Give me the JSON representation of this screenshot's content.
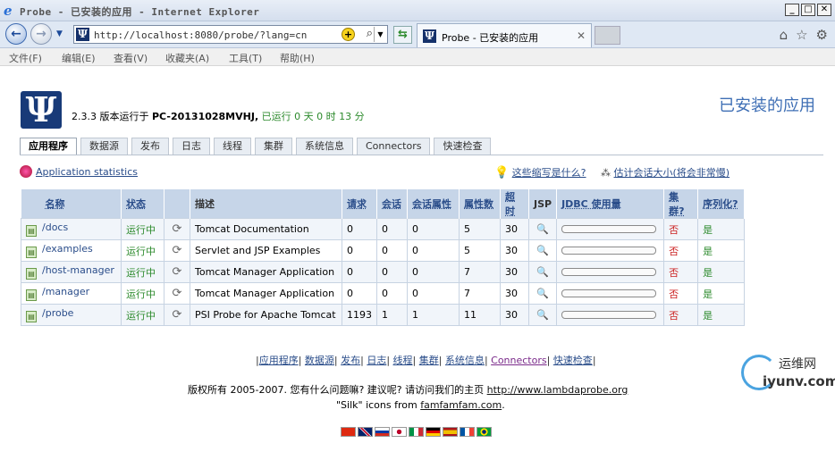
{
  "window": {
    "title": "Probe - 已安装的应用 - Internet Explorer"
  },
  "browser": {
    "url": "http://localhost:8080/probe/?lang=cn",
    "tab_title": "Probe - 已安装的应用",
    "menu": [
      "文件(F)",
      "编辑(E)",
      "查看(V)",
      "收藏夹(A)",
      "工具(T)",
      "帮助(H)"
    ]
  },
  "header": {
    "version_prefix": "2.3.3 版本运行于",
    "host": "PC-20131028MVHJ,",
    "uptime": "已运行 0 天 0 时 13 分",
    "page_title": "已安装的应用"
  },
  "tabs": [
    "应用程序",
    "数据源",
    "发布",
    "日志",
    "线程",
    "集群",
    "系统信息",
    "Connectors",
    "快速检查"
  ],
  "links": {
    "app_stats": "Application statistics",
    "abbr": "这些缩写是什么?",
    "estimate": "估计会话大小(将会非常慢)"
  },
  "table": {
    "headers": [
      "名称",
      "状态",
      "",
      "描述",
      "请求",
      "会话",
      "会话属性",
      "属性数",
      "超时",
      "JSP",
      "JDBC 使用量",
      "集群?",
      "序列化?"
    ],
    "rows": [
      {
        "name": "/docs",
        "status": "运行中",
        "desc": "Tomcat Documentation",
        "req": "0",
        "sess": "0",
        "sattr": "0",
        "attrs": "5",
        "timeout": "30",
        "cluster": "否",
        "serial": "是"
      },
      {
        "name": "/examples",
        "status": "运行中",
        "desc": "Servlet and JSP Examples",
        "req": "0",
        "sess": "0",
        "sattr": "0",
        "attrs": "5",
        "timeout": "30",
        "cluster": "否",
        "serial": "是"
      },
      {
        "name": "/host-manager",
        "status": "运行中",
        "desc": "Tomcat Manager Application",
        "req": "0",
        "sess": "0",
        "sattr": "0",
        "attrs": "7",
        "timeout": "30",
        "cluster": "否",
        "serial": "是"
      },
      {
        "name": "/manager",
        "status": "运行中",
        "desc": "Tomcat Manager Application",
        "req": "0",
        "sess": "0",
        "sattr": "0",
        "attrs": "7",
        "timeout": "30",
        "cluster": "否",
        "serial": "是"
      },
      {
        "name": "/probe",
        "status": "运行中",
        "desc": "PSI Probe for Apache Tomcat",
        "req": "1193",
        "sess": "1",
        "sattr": "1",
        "attrs": "11",
        "timeout": "30",
        "cluster": "否",
        "serial": "是"
      }
    ]
  },
  "footer": {
    "nav": [
      "应用程序",
      "数据源",
      "发布",
      "日志",
      "线程",
      "集群",
      "系统信息",
      "Connectors",
      "快速检查"
    ],
    "copyright": "版权所有 2005-2007. 您有什么问题嘛? 建议呢? 请访问我们的主页",
    "homepage": "http://www.lambdaprobe.org",
    "silk_prefix": "\"Silk\" icons from",
    "silk_link": "famfamfam.com",
    "silk_suffix": "."
  },
  "watermark": {
    "cn": "运维网",
    "en": "iyunv.com"
  }
}
